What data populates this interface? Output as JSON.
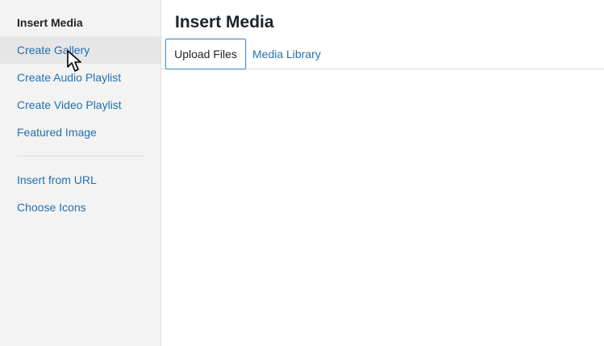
{
  "sidebar": {
    "active_title": "Insert Media",
    "items": [
      {
        "label": "Create Gallery"
      },
      {
        "label": "Create Audio Playlist"
      },
      {
        "label": "Create Video Playlist"
      },
      {
        "label": "Featured Image"
      },
      {
        "label": "Insert from URL"
      },
      {
        "label": "Choose Icons"
      }
    ]
  },
  "main": {
    "title": "Insert Media",
    "tabs": [
      {
        "label": "Upload Files",
        "selected": true
      },
      {
        "label": "Media Library",
        "selected": false
      }
    ]
  },
  "colors": {
    "link": "#2271b1",
    "sidebar_bg": "#f3f3f3",
    "focus_border": "#4f94d4"
  },
  "icons": {
    "cursor": "mouse-pointer-icon"
  }
}
